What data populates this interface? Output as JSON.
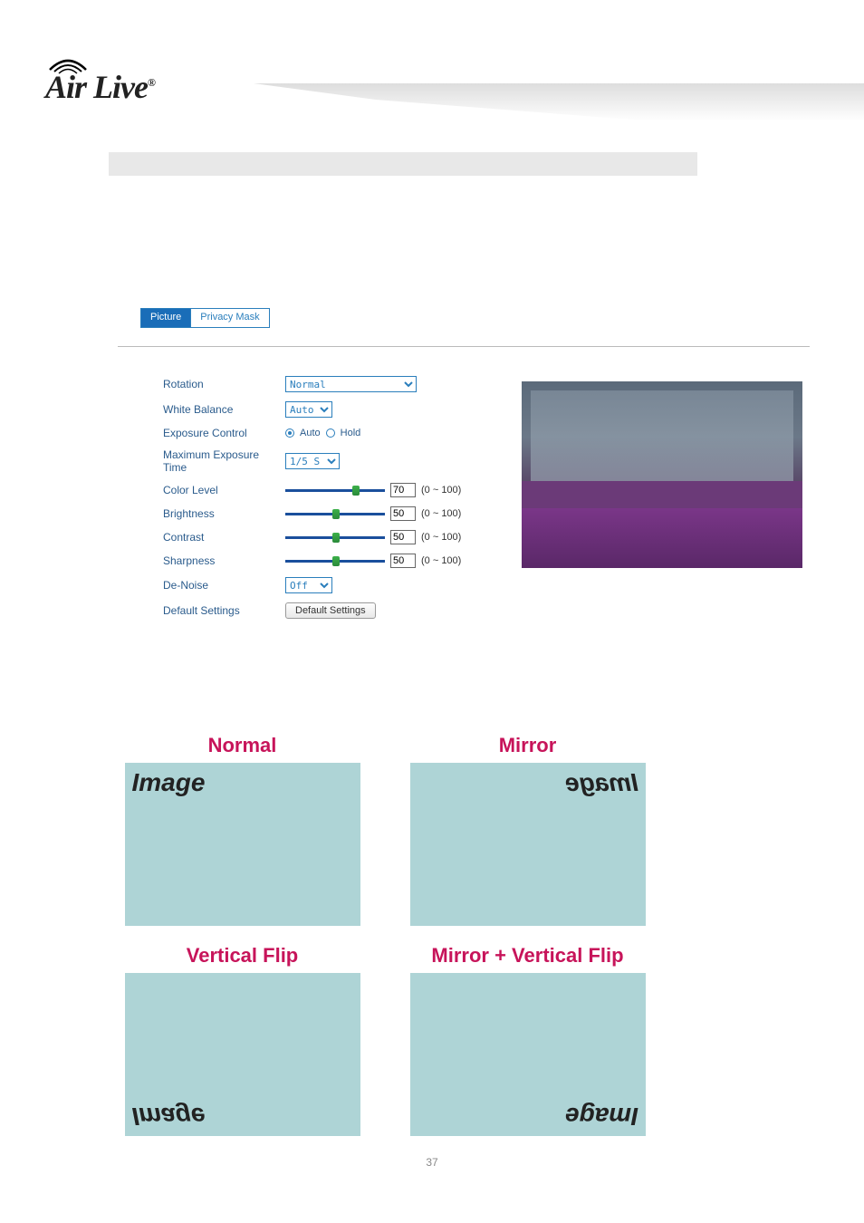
{
  "logo": {
    "text": "Air Live",
    "reg": "®"
  },
  "tabs": {
    "active": "Picture",
    "inactive": "Privacy Mask"
  },
  "settings": {
    "rotation": {
      "label": "Rotation",
      "value": "Normal"
    },
    "white_balance": {
      "label": "White Balance",
      "value": "Auto"
    },
    "exposure_control": {
      "label": "Exposure Control",
      "auto": "Auto",
      "hold": "Hold"
    },
    "max_exposure": {
      "label": "Maximum Exposure Time",
      "value": "1/5 S"
    },
    "color_level": {
      "label": "Color Level",
      "value": "70",
      "range": "(0 ~ 100)"
    },
    "brightness": {
      "label": "Brightness",
      "value": "50",
      "range": "(0 ~ 100)"
    },
    "contrast": {
      "label": "Contrast",
      "value": "50",
      "range": "(0 ~ 100)"
    },
    "sharpness": {
      "label": "Sharpness",
      "value": "50",
      "range": "(0 ~ 100)"
    },
    "denoise": {
      "label": "De-Noise",
      "value": "Off"
    },
    "default": {
      "label": "Default Settings",
      "button": "Default Settings"
    }
  },
  "diagrams": {
    "normal": {
      "title": "Normal",
      "word": "Image"
    },
    "mirror": {
      "title": "Mirror",
      "word": "Image"
    },
    "vflip": {
      "title": "Vertical Flip",
      "word": "Image"
    },
    "mvflip": {
      "title": "Mirror + Vertical Flip",
      "word": "Image"
    }
  },
  "page_number": "37"
}
